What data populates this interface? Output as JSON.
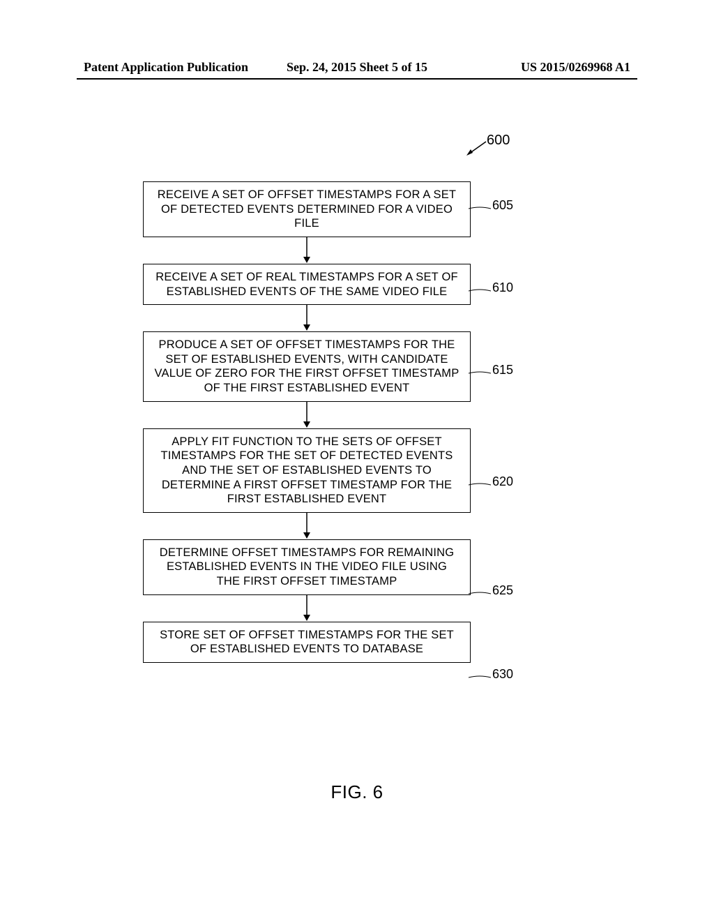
{
  "header": {
    "left": "Patent Application Publication",
    "mid": "Sep. 24, 2015  Sheet 5 of 15",
    "right": "US 2015/0269968 A1"
  },
  "figure_ref": "600",
  "steps": [
    {
      "ref": "605",
      "text": "RECEIVE A SET OF OFFSET TIMESTAMPS FOR A SET OF DETECTED EVENTS DETERMINED FOR A VIDEO FILE"
    },
    {
      "ref": "610",
      "text": "RECEIVE A SET OF REAL TIMESTAMPS FOR A SET OF ESTABLISHED EVENTS OF THE SAME VIDEO FILE"
    },
    {
      "ref": "615",
      "text": "PRODUCE A SET OF OFFSET TIMESTAMPS FOR THE SET OF ESTABLISHED EVENTS, WITH CANDIDATE VALUE OF ZERO FOR THE FIRST OFFSET TIMESTAMP OF THE FIRST ESTABLISHED EVENT"
    },
    {
      "ref": "620",
      "text": "APPLY FIT FUNCTION TO THE SETS OF OFFSET TIMESTAMPS FOR THE SET OF DETECTED EVENTS AND THE SET OF ESTABLISHED EVENTS TO DETERMINE A FIRST OFFSET TIMESTAMP FOR THE FIRST ESTABLISHED EVENT"
    },
    {
      "ref": "625",
      "text": "DETERMINE OFFSET TIMESTAMPS FOR REMAINING ESTABLISHED EVENTS IN THE VIDEO FILE USING THE FIRST OFFSET TIMESTAMP"
    },
    {
      "ref": "630",
      "text": "STORE SET OF OFFSET TIMESTAMPS FOR THE SET OF ESTABLISHED EVENTS TO DATABASE"
    }
  ],
  "caption": "FIG. 6"
}
